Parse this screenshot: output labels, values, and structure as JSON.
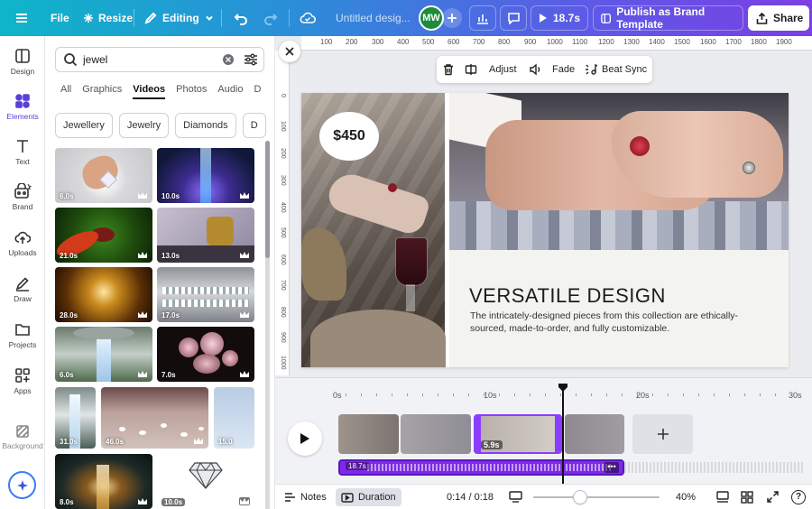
{
  "topbar": {
    "file": "File",
    "resize": "Resize",
    "editing": "Editing",
    "title": "Untitled desig...",
    "avatar_initials": "MW",
    "play_duration": "18.7s",
    "publish": "Publish as Brand Template",
    "share": "Share"
  },
  "rail": {
    "items": [
      {
        "label": "Design",
        "icon": "layout-icon"
      },
      {
        "label": "Elements",
        "icon": "shapes-icon"
      },
      {
        "label": "Text",
        "icon": "text-icon"
      },
      {
        "label": "Brand",
        "icon": "brand-icon"
      },
      {
        "label": "Uploads",
        "icon": "cloud-upload-icon"
      },
      {
        "label": "Draw",
        "icon": "pen-icon"
      },
      {
        "label": "Projects",
        "icon": "folder-icon"
      },
      {
        "label": "Apps",
        "icon": "apps-icon"
      },
      {
        "label": "Background",
        "icon": "background-icon"
      }
    ]
  },
  "panel": {
    "search_value": "jewel",
    "tabs": [
      "All",
      "Graphics",
      "Videos",
      "Photos",
      "Audio",
      "D"
    ],
    "active_tab": "Videos",
    "chips": [
      "Jewellery",
      "Jewelry",
      "Diamonds",
      "D"
    ],
    "videos": [
      "6.0s",
      "10.0s",
      "21.0s",
      "13.0s",
      "28.0s",
      "17.0s",
      "6.0s",
      "7.0s",
      "31.0s",
      "46.0s",
      "15.0",
      "8.0s",
      "10.0s"
    ]
  },
  "ruler": {
    "top": [
      "100",
      "200",
      "300",
      "400",
      "500",
      "600",
      "700",
      "800",
      "900",
      "1000",
      "1100",
      "1200",
      "1300",
      "1400",
      "1500",
      "1600",
      "1700",
      "1800",
      "1900"
    ],
    "left": [
      "0",
      "100",
      "200",
      "300",
      "400",
      "500",
      "600",
      "700",
      "800",
      "900",
      "1000"
    ]
  },
  "toolbar": {
    "adjust": "Adjust",
    "fade": "Fade",
    "beat_sync": "Beat Sync"
  },
  "canvas": {
    "price": "$450",
    "heading": "VERSATILE DESIGN",
    "body": "The intricately-designed pieces from this collection are ethically-sourced, made-to-order, and fully customizable."
  },
  "timeline": {
    "marks": [
      "0s",
      "10s",
      "20s",
      "30s"
    ],
    "selected_clip_duration": "5.9s",
    "audio_duration": "18.7s"
  },
  "bottom": {
    "notes": "Notes",
    "duration": "Duration",
    "time": "0:14 / 0:18",
    "zoom": "40%",
    "zoom_level": 0.4
  },
  "colors": {
    "accent": "#7d2ae8",
    "selection": "#8b3dff"
  }
}
